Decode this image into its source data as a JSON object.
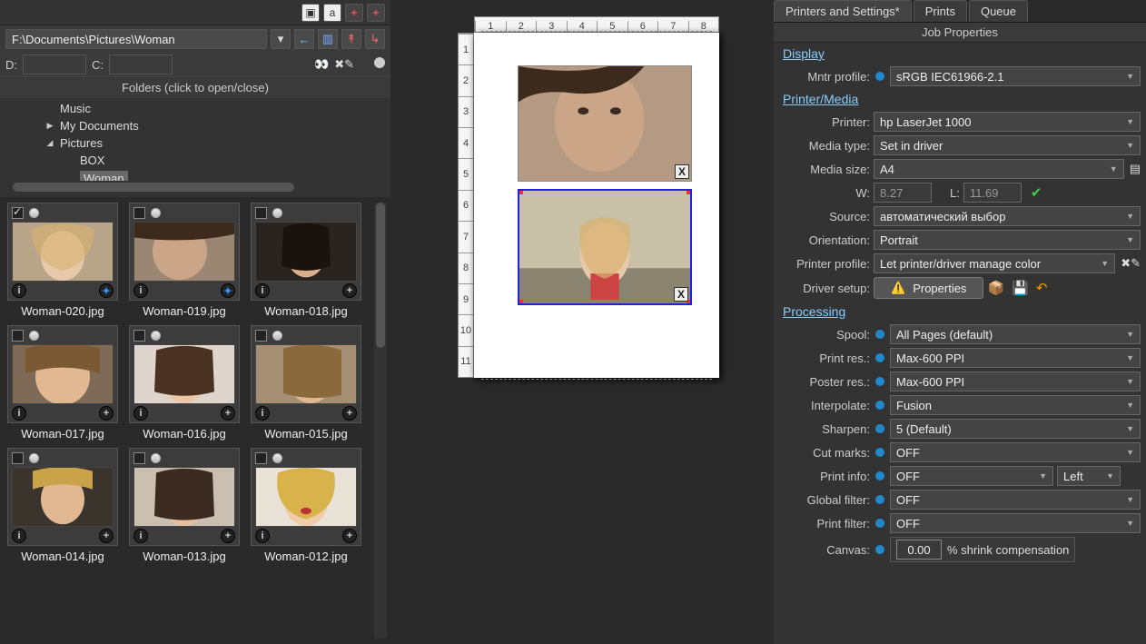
{
  "path": "F:\\Documents\\Pictures\\Woman",
  "drives": {
    "d_label": "D:",
    "c_label": "C:"
  },
  "folders_header": "Folders (click to open/close)",
  "tree": {
    "music": "Music",
    "mydocs": "My Documents",
    "pictures": "Pictures",
    "box": "BOX",
    "woman": "Woman"
  },
  "thumbs": [
    {
      "name": "Woman-020.jpg",
      "checked": true,
      "added": true
    },
    {
      "name": "Woman-019.jpg",
      "checked": false,
      "added": true
    },
    {
      "name": "Woman-018.jpg",
      "checked": false,
      "added": false
    },
    {
      "name": "Woman-017.jpg",
      "checked": false,
      "added": false
    },
    {
      "name": "Woman-016.jpg",
      "checked": false,
      "added": false
    },
    {
      "name": "Woman-015.jpg",
      "checked": false,
      "added": false
    },
    {
      "name": "Woman-014.jpg",
      "checked": false,
      "added": false
    },
    {
      "name": "Woman-013.jpg",
      "checked": false,
      "added": false
    },
    {
      "name": "Woman-012.jpg",
      "checked": false,
      "added": false
    }
  ],
  "hruler": [
    "1",
    "2",
    "3",
    "4",
    "5",
    "6",
    "7",
    "8"
  ],
  "vruler": [
    "1",
    "2",
    "3",
    "4",
    "5",
    "6",
    "7",
    "8",
    "9",
    "10",
    "11"
  ],
  "tabs": {
    "printers": "Printers and Settings*",
    "prints": "Prints",
    "queue": "Queue"
  },
  "jp_header": "Job Properties",
  "sections": {
    "display": "Display",
    "printer_media": "Printer/Media",
    "processing": "Processing"
  },
  "labels": {
    "mntr_profile": "Mntr profile:",
    "printer": "Printer:",
    "media_type": "Media type:",
    "media_size": "Media size:",
    "w": "W:",
    "l": "L:",
    "source": "Source:",
    "orientation": "Orientation:",
    "printer_profile": "Printer profile:",
    "driver_setup": "Driver setup:",
    "properties_btn": "Properties",
    "spool": "Spool:",
    "print_res": "Print res.:",
    "poster_res": "Poster res.:",
    "interpolate": "Interpolate:",
    "sharpen": "Sharpen:",
    "cut_marks": "Cut marks:",
    "print_info": "Print info:",
    "global_filter": "Global filter:",
    "print_filter": "Print filter:",
    "canvas": "Canvas:",
    "shrink_comp": "% shrink compensation"
  },
  "values": {
    "mntr_profile": "sRGB IEC61966-2.1",
    "printer": "hp LaserJet 1000",
    "media_type": "Set in driver",
    "media_size": "A4",
    "w": "8.27",
    "l": "11.69",
    "source": "автоматический выбор",
    "orientation": "Portrait",
    "printer_profile": "Let printer/driver manage color",
    "spool": "All Pages (default)",
    "print_res": "Max-600 PPI",
    "poster_res": "Max-600 PPI",
    "interpolate": "Fusion",
    "sharpen": "5 (Default)",
    "cut_marks": "OFF",
    "print_info": "OFF",
    "print_info_side": "Left",
    "global_filter": "OFF",
    "print_filter": "OFF",
    "canvas": "0.00"
  }
}
